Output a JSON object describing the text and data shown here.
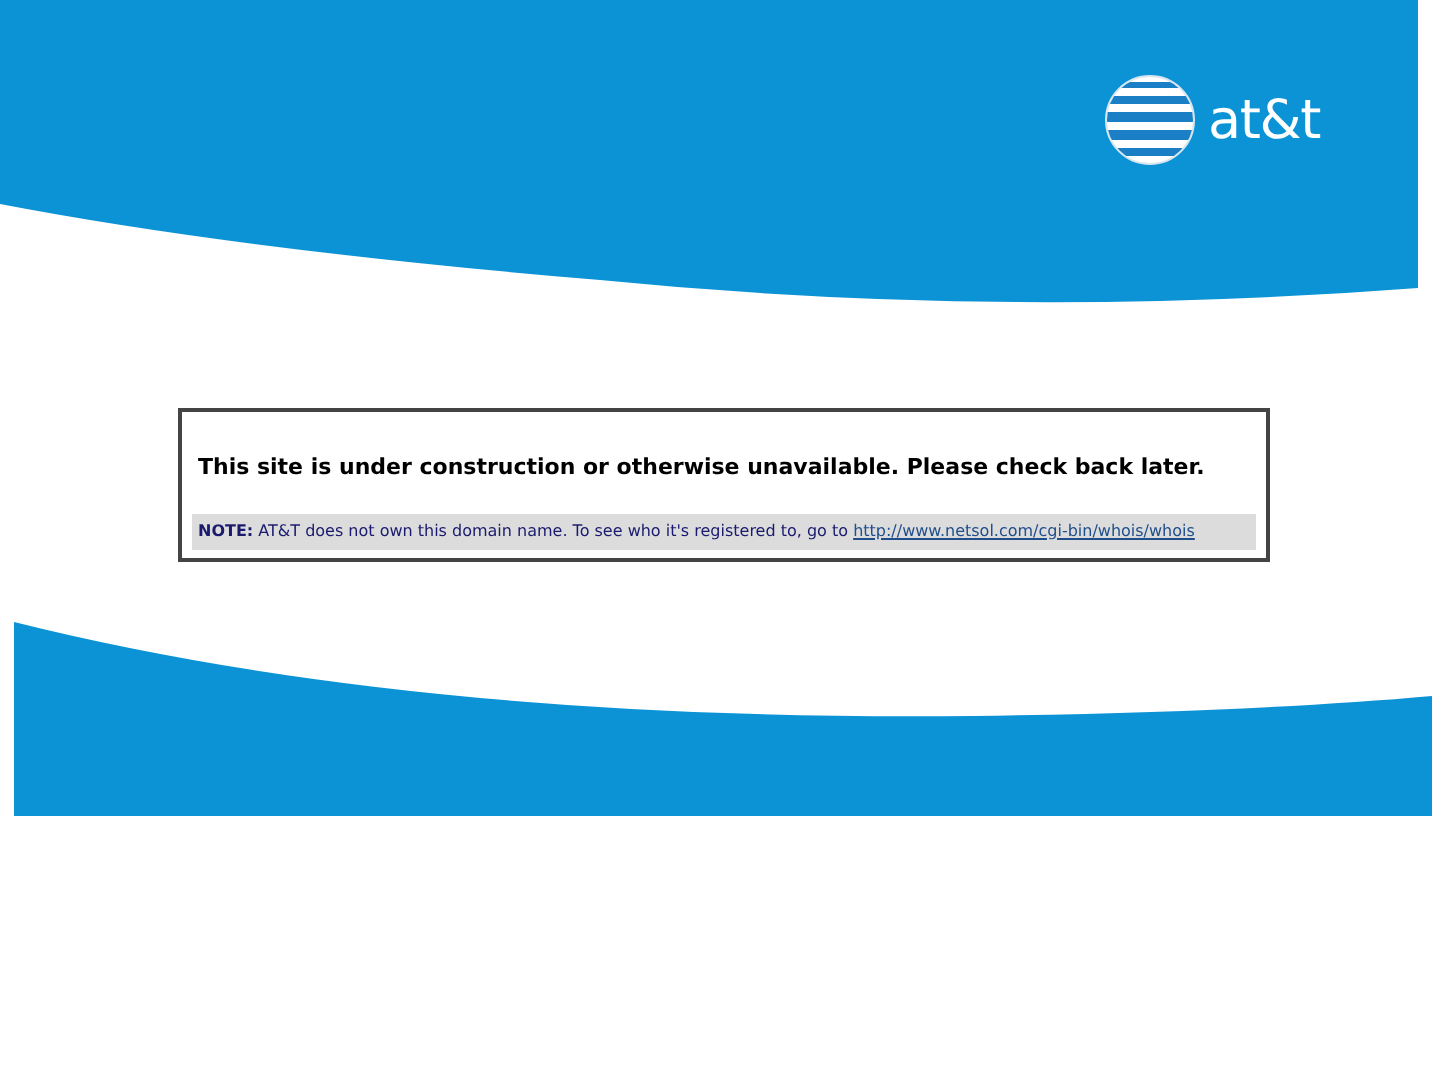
{
  "logo": {
    "text": "at&t"
  },
  "message": "This site is under construction or otherwise unavailable. Please check back later.",
  "note": {
    "text": "**NOTE:** AT&T does not own this domain name. To see who it's registered to, go to",
    "link": "http://www.netsol.com/cgi-bin/whois/whois"
  }
}
